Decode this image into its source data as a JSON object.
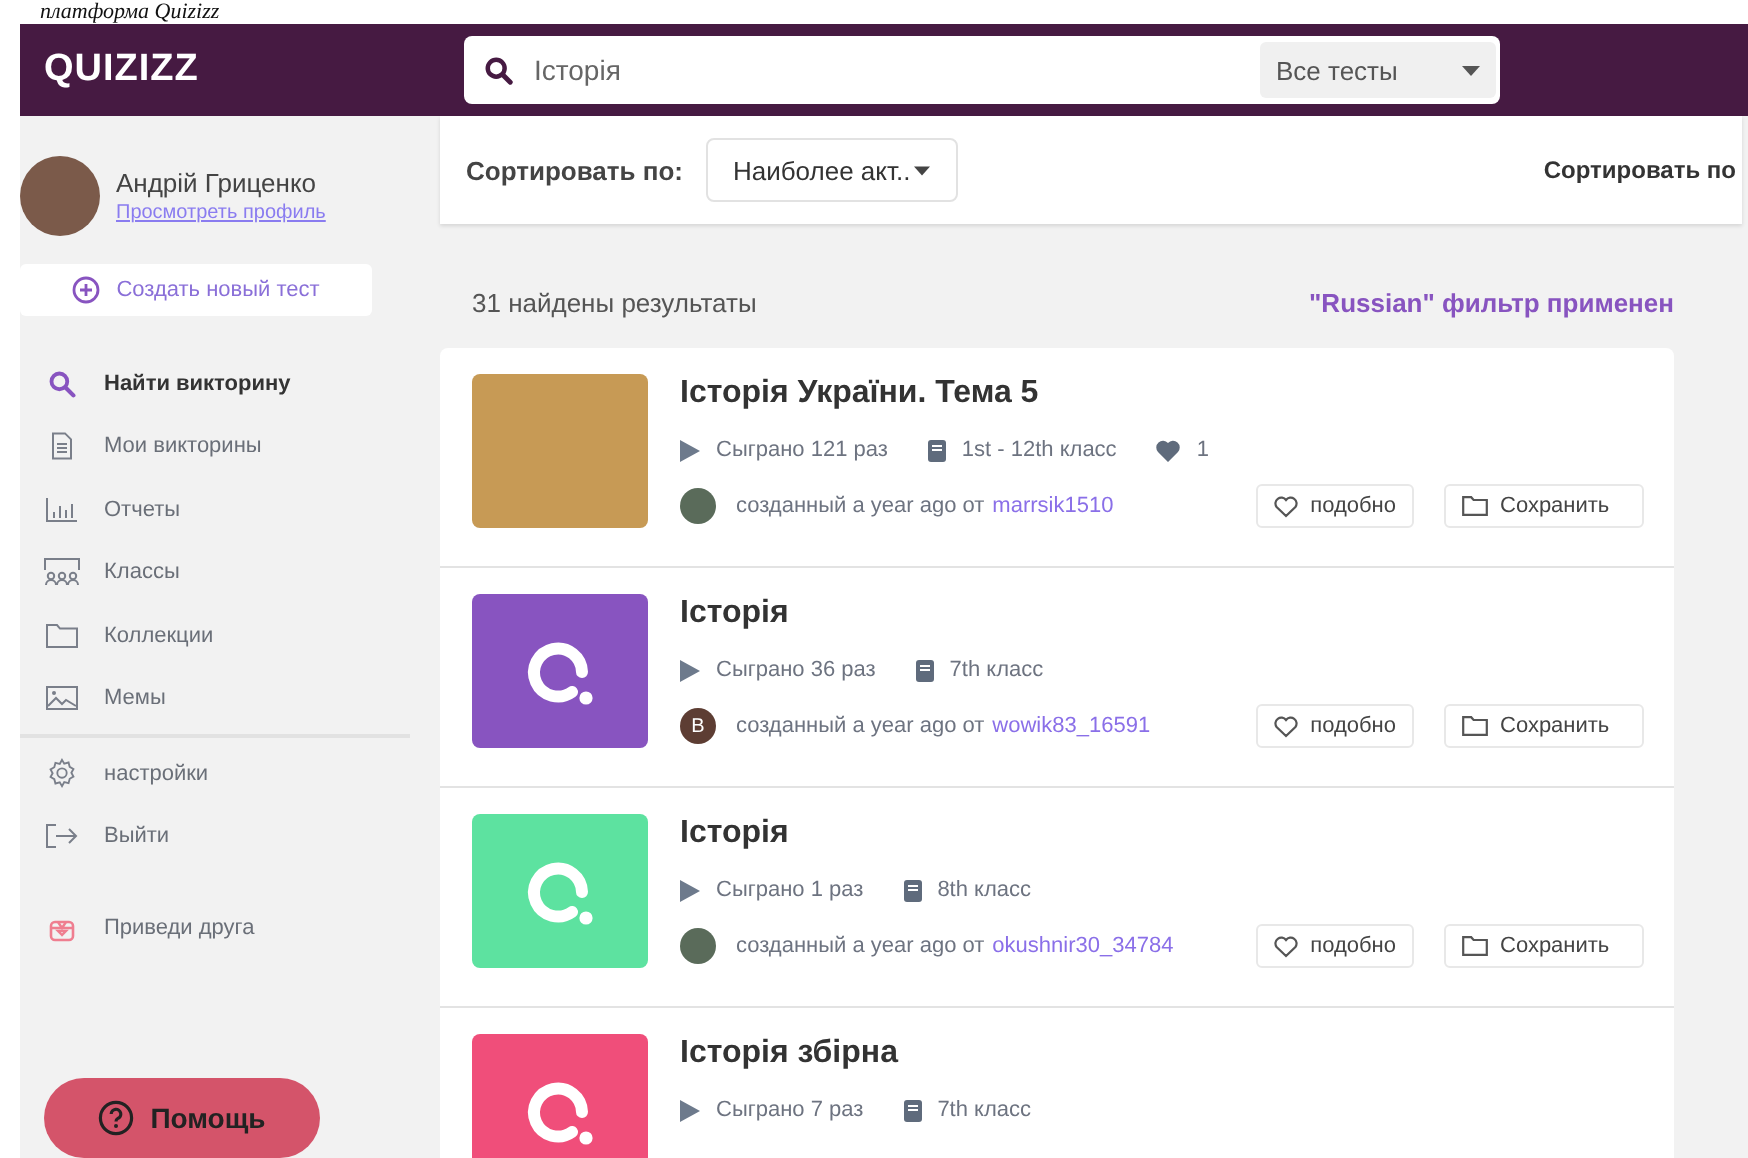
{
  "caption": "платформа Quizizz",
  "header": {
    "logo": "QUIZIZZ",
    "search": {
      "value": "Історія"
    },
    "filter": "Все тесты"
  },
  "sidebar": {
    "user": {
      "name": "Андрій Гриценко",
      "link": "Просмотреть профиль"
    },
    "create_button": "Создать новый тест",
    "items": [
      {
        "label": "Найти викторину",
        "selected": true
      },
      {
        "label": "Мои викторины",
        "selected": false
      },
      {
        "label": "Отчеты",
        "selected": false
      },
      {
        "label": "Классы",
        "selected": false
      },
      {
        "label": "Коллекции",
        "selected": false
      },
      {
        "label": "Мемы",
        "selected": false
      }
    ],
    "secondary": [
      {
        "label": "настройки"
      },
      {
        "label": "Выйти"
      }
    ],
    "invite": "Приведи друга",
    "help": "Помощь"
  },
  "sort_bar": {
    "label": "Сортировать по:",
    "value": "Наиболее акт..",
    "right_label": "Сортировать по"
  },
  "results": {
    "count": "31 найдены результаты",
    "filter_note": "\"Russian\" фильтр применен",
    "items": [
      {
        "title": "Історія України. Тема 5",
        "thumbnail": {
          "kind": "photo"
        },
        "plays": "Сыграно 121 раз",
        "grade": "1st - 12th класс",
        "likes": "1",
        "author": {
          "avatar": {
            "kind": "photo"
          },
          "created": "созданный a year ago от",
          "user": "marrsik1510"
        },
        "like_button": "подобно",
        "save_button": "Сохранить"
      },
      {
        "title": "Історія",
        "thumbnail": {
          "kind": "logo",
          "color": "#8854c0"
        },
        "plays": "Сыграно 36 раз",
        "grade": "7th класс",
        "author": {
          "avatar": {
            "kind": "letter",
            "text": "В"
          },
          "created": "созданный a year ago от",
          "user": "wowik83_16591"
        },
        "like_button": "подобно",
        "save_button": "Сохранить"
      },
      {
        "title": "Історія",
        "thumbnail": {
          "kind": "logo",
          "color": "#5de2a0"
        },
        "plays": "Сыграно 1 раз",
        "grade": "8th класс",
        "author": {
          "avatar": {
            "kind": "photo"
          },
          "created": "созданный a year ago от",
          "user": "okushnir30_34784"
        },
        "like_button": "подобно",
        "save_button": "Сохранить"
      },
      {
        "title": "Історія збірна",
        "thumbnail": {
          "kind": "logo",
          "color": "#f04e7a"
        },
        "plays": "Сыграно 7 раз",
        "grade": "7th класс"
      }
    ]
  }
}
